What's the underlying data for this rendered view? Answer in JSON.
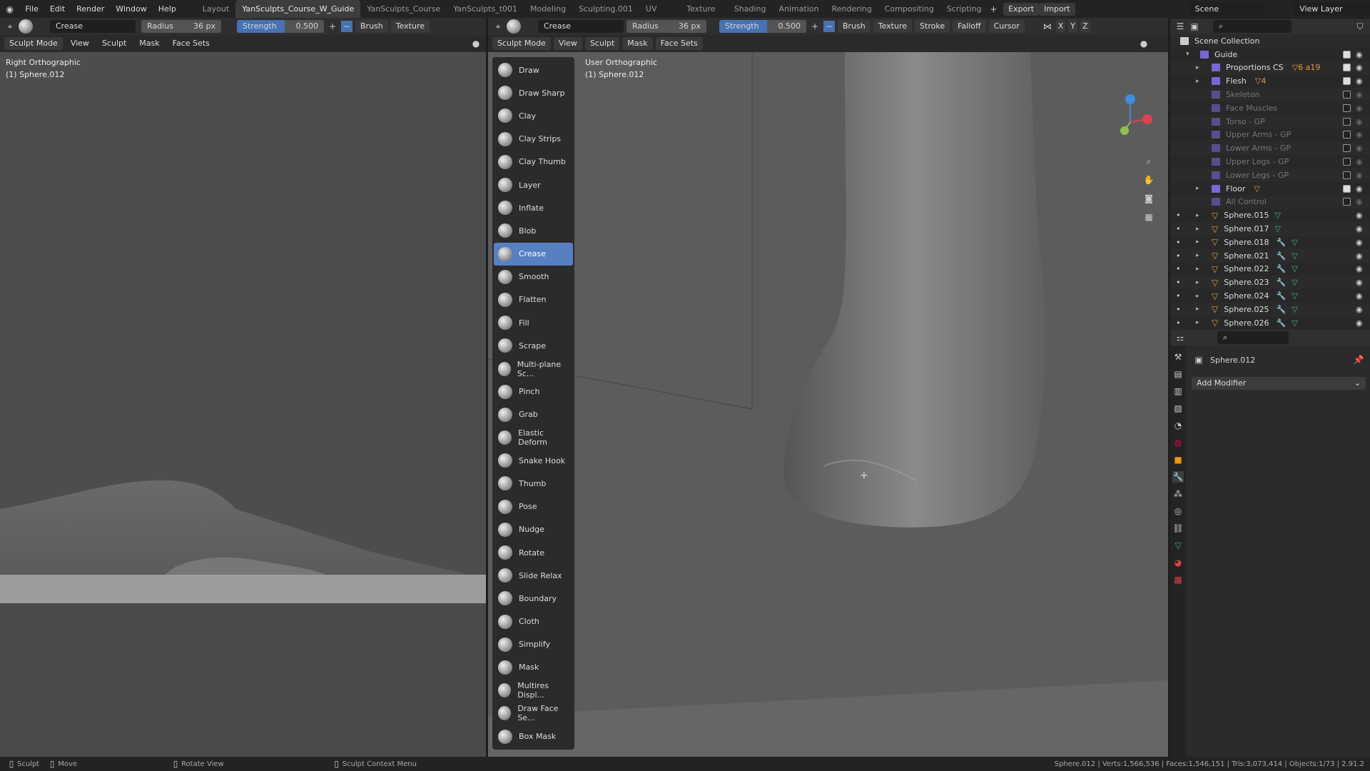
{
  "topbar": {
    "menus": [
      "File",
      "Edit",
      "Render",
      "Window",
      "Help"
    ],
    "workspaces": [
      "Layout",
      "YanSculpts_Course_W_Guide",
      "YanSculpts_Course",
      "YanSculpts_t001",
      "Modeling",
      "Sculpting.001",
      "UV Editing",
      "Texture Paint",
      "Shading",
      "Animation",
      "Rendering",
      "Compositing",
      "Scripting"
    ],
    "active_workspace": 1,
    "export": "Export",
    "import": "Import",
    "scene": "Scene",
    "view_layer": "View Layer"
  },
  "tool_header": {
    "brush": "Crease",
    "radius_label": "Radius",
    "radius": "36 px",
    "strength_label": "Strength",
    "strength": "0.500",
    "menus_left": [
      "Brush",
      "Texture"
    ],
    "menus_right": [
      "Brush",
      "Texture",
      "Stroke",
      "Falloff",
      "Cursor"
    ],
    "axes": [
      "X",
      "Y",
      "Z"
    ]
  },
  "mode_header": {
    "mode": "Sculpt Mode",
    "menus": [
      "View",
      "Sculpt",
      "Mask",
      "Face Sets"
    ]
  },
  "left_viewport": {
    "view": "Right Orthographic",
    "object": "(1) Sphere.012"
  },
  "right_viewport": {
    "view": "User Orthographic",
    "object": "(1) Sphere.012"
  },
  "tools": [
    "Draw",
    "Draw Sharp",
    "Clay",
    "Clay Strips",
    "Clay Thumb",
    "Layer",
    "Inflate",
    "Blob",
    "Crease",
    "Smooth",
    "Flatten",
    "Fill",
    "Scrape",
    "Multi-plane Sc...",
    "Pinch",
    "Grab",
    "Elastic Deform",
    "Snake Hook",
    "Thumb",
    "Pose",
    "Nudge",
    "Rotate",
    "Slide Relax",
    "Boundary",
    "Cloth",
    "Simplify",
    "Mask",
    "Multires Displ...",
    "Draw Face Se...",
    "Box Mask"
  ],
  "active_tool": "Crease",
  "outliner": {
    "root": "Scene Collection",
    "rows": [
      {
        "name": "Guide",
        "type": "collection",
        "level": 0,
        "checked": true,
        "dim": false
      },
      {
        "name": "Proportions CS",
        "type": "collection",
        "level": 1,
        "checked": true,
        "dim": false,
        "badge": "▽6 a19"
      },
      {
        "name": "Flesh",
        "type": "collection",
        "level": 1,
        "checked": true,
        "dim": false,
        "badge": "▽4"
      },
      {
        "name": "Skeleton",
        "type": "collection",
        "level": 1,
        "checked": false,
        "dim": true
      },
      {
        "name": "Face Muscles",
        "type": "collection",
        "level": 1,
        "checked": false,
        "dim": true
      },
      {
        "name": "Torso - GP",
        "type": "collection",
        "level": 1,
        "checked": false,
        "dim": true
      },
      {
        "name": "Upper Arms - GP",
        "type": "collection",
        "level": 1,
        "checked": false,
        "dim": true
      },
      {
        "name": "Lower Arms - GP",
        "type": "collection",
        "level": 1,
        "checked": false,
        "dim": true
      },
      {
        "name": "Upper Legs - GP",
        "type": "collection",
        "level": 1,
        "checked": false,
        "dim": true
      },
      {
        "name": "Lower Legs - GP",
        "type": "collection",
        "level": 1,
        "checked": false,
        "dim": true
      },
      {
        "name": "Floor",
        "type": "collection",
        "level": 1,
        "checked": true,
        "dim": false,
        "badge": "▽"
      },
      {
        "name": "All Control",
        "type": "collection",
        "level": 1,
        "checked": false,
        "dim": true
      },
      {
        "name": "Sphere.015",
        "type": "mesh",
        "level": 1,
        "modifier": false
      },
      {
        "name": "Sphere.017",
        "type": "mesh",
        "level": 1,
        "modifier": false
      },
      {
        "name": "Sphere.018",
        "type": "mesh",
        "level": 1,
        "modifier": true
      },
      {
        "name": "Sphere.021",
        "type": "mesh",
        "level": 1,
        "modifier": true
      },
      {
        "name": "Sphere.022",
        "type": "mesh",
        "level": 1,
        "modifier": true
      },
      {
        "name": "Sphere.023",
        "type": "mesh",
        "level": 1,
        "modifier": true
      },
      {
        "name": "Sphere.024",
        "type": "mesh",
        "level": 1,
        "modifier": true
      },
      {
        "name": "Sphere.025",
        "type": "mesh",
        "level": 1,
        "modifier": true
      },
      {
        "name": "Sphere.026",
        "type": "mesh",
        "level": 1,
        "modifier": true
      }
    ]
  },
  "properties": {
    "object": "Sphere.012",
    "add_modifier": "Add Modifier"
  },
  "status": {
    "items": [
      "Sculpt",
      "Move",
      "Rotate View",
      "Sculpt Context Menu"
    ],
    "stats": "Sphere.012 | Verts:1,566,536 | Faces:1,546,151 | Tris:3,073,414 | Objects:1/73 | 2.91.2"
  },
  "colors": {
    "accent": "#4772b3",
    "active_tool": "#5680c2",
    "collection": "#7b66d6",
    "mesh": "#e59a3a"
  }
}
